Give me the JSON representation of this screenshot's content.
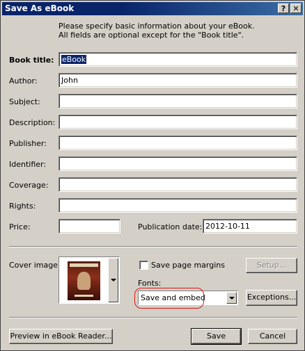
{
  "window": {
    "title": "Save As eBook",
    "help_label": "?",
    "close_label": "✕"
  },
  "intro": {
    "line1": "Please specify basic information about your eBook.",
    "line2": "All fields are optional except for the \"Book title\"."
  },
  "fields": {
    "book_title": {
      "label": "Book title:",
      "value": "eBook"
    },
    "author": {
      "label": "Author:",
      "value": "John"
    },
    "subject": {
      "label": "Subject:",
      "value": ""
    },
    "description": {
      "label": "Description:",
      "value": ""
    },
    "publisher": {
      "label": "Publisher:",
      "value": ""
    },
    "identifier": {
      "label": "Identifier:",
      "value": ""
    },
    "coverage": {
      "label": "Coverage:",
      "value": ""
    },
    "rights": {
      "label": "Rights:",
      "value": ""
    },
    "price": {
      "label": "Price:",
      "value": ""
    },
    "publication_date": {
      "label": "Publication date:",
      "value": "2012-10-11"
    }
  },
  "cover": {
    "label": "Cover image:"
  },
  "options": {
    "save_page_margins_label": "Save page margins",
    "save_page_margins_checked": false,
    "setup_label": "Setup...",
    "fonts_label": "Fonts:",
    "fonts_value": "Save and embed",
    "exceptions_label": "Exceptions..."
  },
  "footer": {
    "preview_label": "Preview in eBook Reader...",
    "save_label": "Save",
    "cancel_label": "Cancel"
  },
  "colors": {
    "title_bar": "#0a246a",
    "face": "#d4d0c8",
    "highlight_ring": "#e01010"
  }
}
